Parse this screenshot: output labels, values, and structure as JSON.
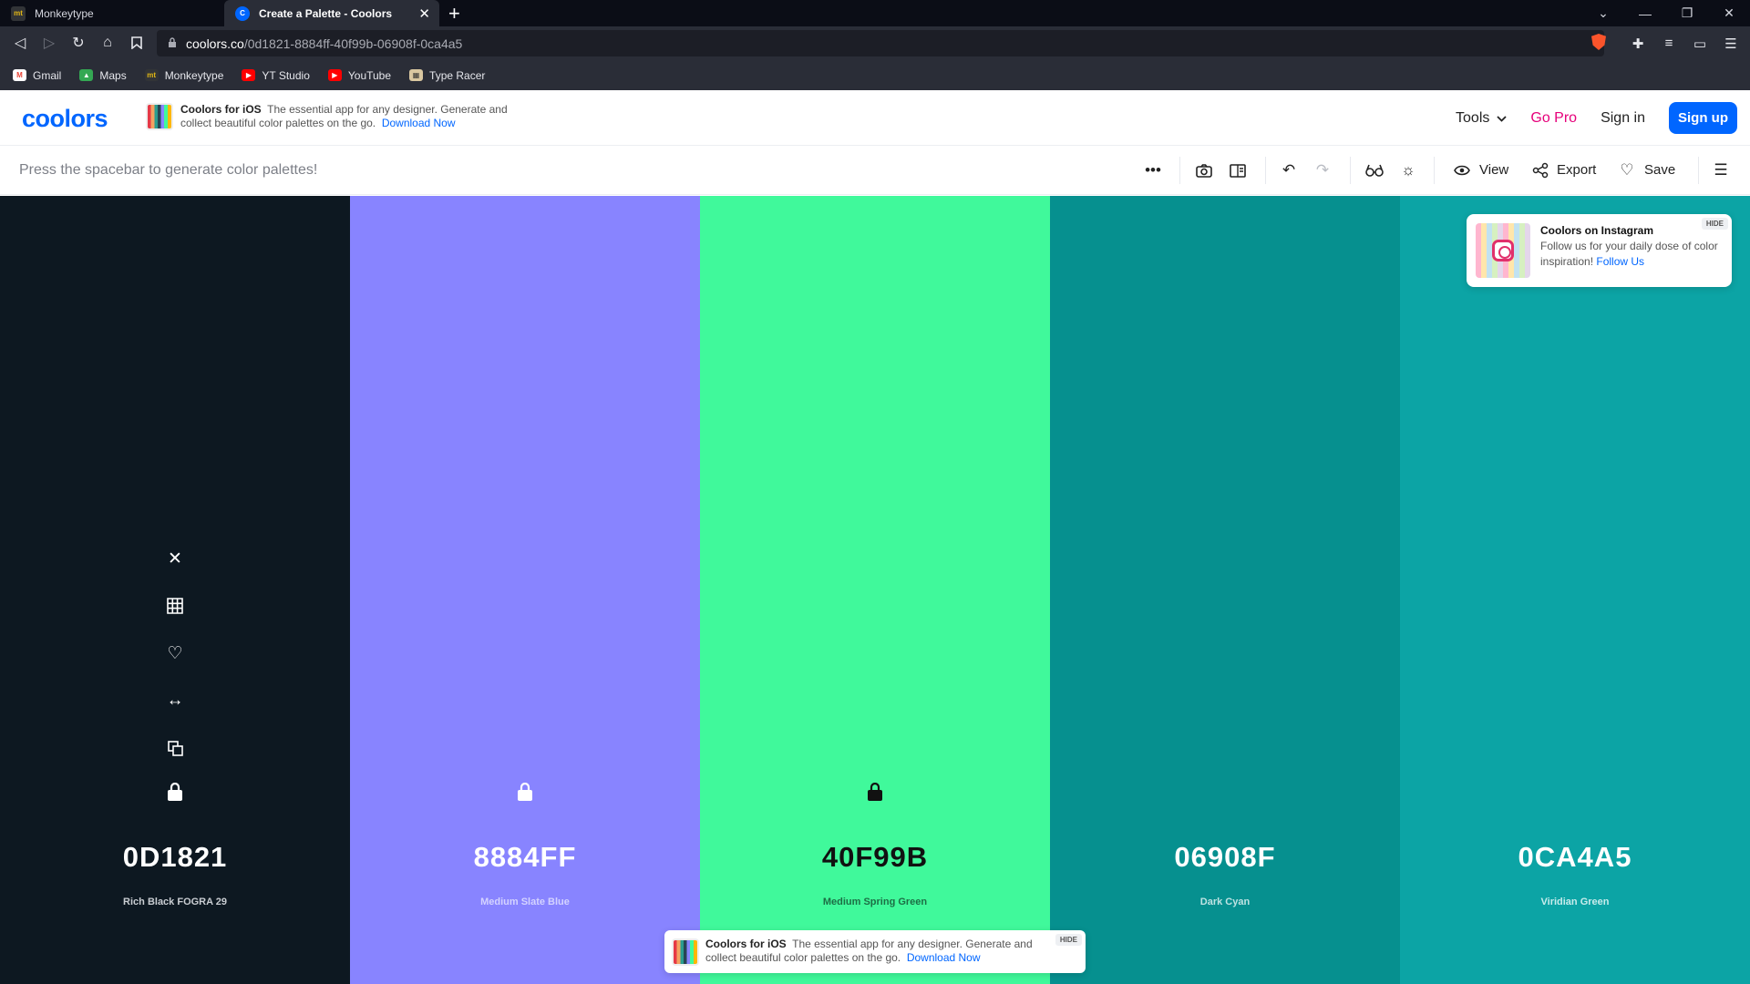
{
  "browser": {
    "tabs": [
      {
        "title": "Monkeytype",
        "active": false
      },
      {
        "title": "Create a Palette - Coolors",
        "active": true
      }
    ],
    "url_host": "coolors.co",
    "url_path": "/0d1821-8884ff-40f99b-06908f-0ca4a5",
    "bookmarks": [
      "Gmail",
      "Maps",
      "Monkeytype",
      "YT Studio",
      "YouTube",
      "Type Racer"
    ]
  },
  "header": {
    "logo": "coolors",
    "ios_promo": {
      "title": "Coolors for iOS",
      "text": "The essential app for any designer. Generate and collect beautiful color palettes on the go.",
      "link": "Download Now"
    },
    "nav": {
      "tools": "Tools",
      "gopro": "Go Pro",
      "signin": "Sign in",
      "signup": "Sign up"
    }
  },
  "toolbar": {
    "hint": "Press the spacebar to generate color palettes!",
    "view": "View",
    "export": "Export",
    "save": "Save"
  },
  "palette": [
    {
      "hex": "0D1821",
      "name": "Rich Black FOGRA 29",
      "color": "#0d1821",
      "text_color": "#ffffff",
      "sub_color": "#c9cdd2"
    },
    {
      "hex": "8884FF",
      "name": "Medium Slate Blue",
      "color": "#8884ff",
      "text_color": "#ffffff",
      "sub_color": "#d4d3ff"
    },
    {
      "hex": "40F99B",
      "name": "Medium Spring Green",
      "color": "#40f99b",
      "text_color": "#111111",
      "sub_color": "#1d6e45"
    },
    {
      "hex": "06908F",
      "name": "Dark Cyan",
      "color": "#06908f",
      "text_color": "#ffffff",
      "sub_color": "#bfe3e3"
    },
    {
      "hex": "0CA4A5",
      "name": "Viridian Green",
      "color": "#0ca4a5",
      "text_color": "#ffffff",
      "sub_color": "#c8ecec"
    }
  ],
  "instagram": {
    "title": "Coolors on Instagram",
    "text": "Follow us for your daily dose of color inspiration!",
    "link": "Follow Us",
    "hide": "HIDE"
  },
  "bottom_promo": {
    "title": "Coolors for iOS",
    "text": "The essential app for any designer. Generate and collect beautiful color palettes on the go.",
    "link": "Download Now",
    "hide": "HIDE"
  }
}
